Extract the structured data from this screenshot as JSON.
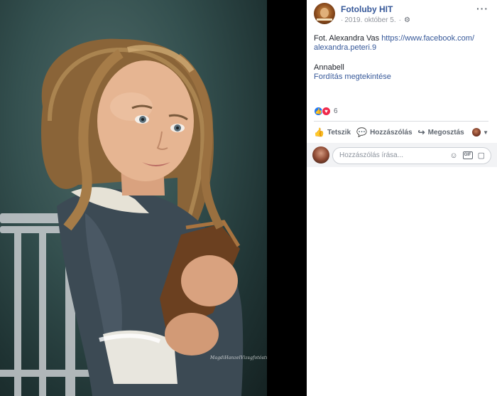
{
  "post": {
    "page_name": "Fotoluby HIT",
    "date": "2019. október 5.",
    "separator": "·",
    "text_prefix": "Fot. Alexandra Vas ",
    "link_line1": "https://www.facebook.com/",
    "link_line2": "alexandra.peteri.9",
    "caption": "Annabell",
    "translate": "Fordítás megtekintése",
    "reaction_count": "6",
    "actions": {
      "like": "Tetszik",
      "comment": "Hozzászólás",
      "share": "Megosztás"
    },
    "comment_placeholder": "Hozzászólás írása...",
    "icons": {
      "more": "more-dots-icon",
      "privacy": "gear-icon",
      "like": "thumbs-up-icon",
      "comment": "comment-bubble-icon",
      "share": "share-arrow-icon",
      "emoji": "emoji-icon",
      "gif": "gif-icon",
      "sticker": "sticker-icon"
    }
  },
  "colors": {
    "link": "#365899",
    "like_blue": "#2078f4",
    "love_red": "#f0284a",
    "muted": "#90949c"
  }
}
